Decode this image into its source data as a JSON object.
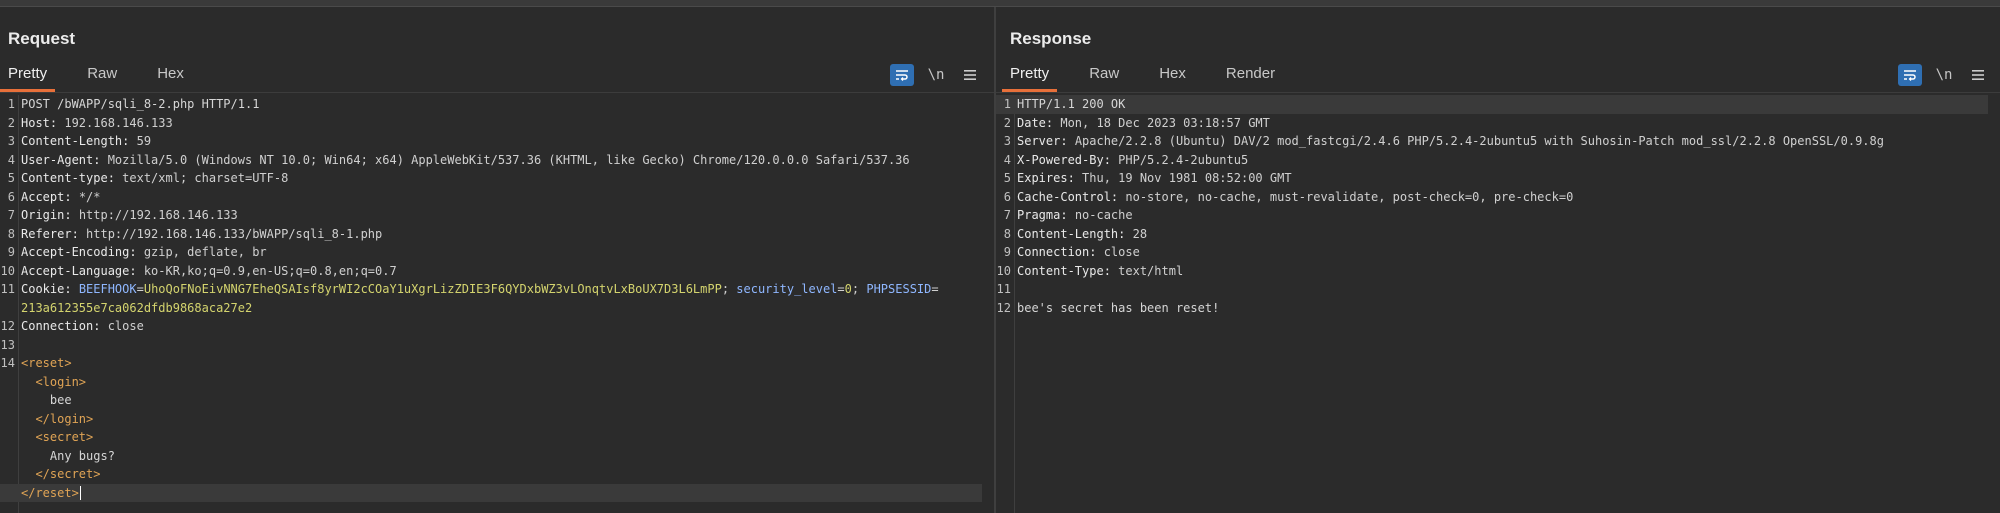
{
  "request": {
    "title": "Request",
    "tabs": [
      "Pretty",
      "Raw",
      "Hex"
    ],
    "active_tab": "Pretty",
    "newline_toggle": "\\n",
    "lines": [
      {
        "n": "1",
        "text": "POST /bWAPP/sqli_8-2.php HTTP/1.1"
      },
      {
        "n": "2",
        "key": "Host",
        "val": "192.168.146.133"
      },
      {
        "n": "3",
        "key": "Content-Length",
        "val": "59"
      },
      {
        "n": "4",
        "key": "User-Agent",
        "val": "Mozilla/5.0 (Windows NT 10.0; Win64; x64) AppleWebKit/537.36 (KHTML, like Gecko) Chrome/120.0.0.0 Safari/537.36"
      },
      {
        "n": "5",
        "key": "Content-type",
        "val": "text/xml; charset=UTF-8"
      },
      {
        "n": "6",
        "key": "Accept",
        "val": "*/*"
      },
      {
        "n": "7",
        "key": "Origin",
        "val": "http://192.168.146.133"
      },
      {
        "n": "8",
        "key": "Referer",
        "val": "http://192.168.146.133/bWAPP/sqli_8-1.php"
      },
      {
        "n": "9",
        "key": "Accept-Encoding",
        "val": "gzip, deflate, br"
      },
      {
        "n": "10",
        "key": "Accept-Language",
        "val": "ko-KR,ko;q=0.9,en-US;q=0.8,en;q=0.7"
      },
      {
        "n": "11",
        "cookie": {
          "key": "Cookie",
          "name1": "BEEFHOOK",
          "val1": "UhoQoFNoEivNNG7EheQSAIsf8yrWI2cCOaY1uXgrLizZDIE3F6QYDxbWZ3vLOnqtvLxBoUX7D3L6LmPP",
          "name2": "security_level",
          "val2": "0",
          "name3": "PHPSESSID",
          "val3a": "",
          "val3b": "213a612355e7ca062dfdb9868aca27e2"
        }
      },
      {
        "n": "12",
        "key": "Connection",
        "val": "close"
      },
      {
        "n": "13",
        "text": ""
      },
      {
        "n": "14",
        "xml": "<reset>"
      },
      {
        "n": "",
        "xml": "  <login>"
      },
      {
        "n": "",
        "xml": "    bee"
      },
      {
        "n": "",
        "xml": "  </login>"
      },
      {
        "n": "",
        "xml": "  <secret>"
      },
      {
        "n": "",
        "xml": "    Any bugs?"
      },
      {
        "n": "",
        "xml": "  </secret>"
      },
      {
        "n": "",
        "xml": "</reset>"
      }
    ]
  },
  "response": {
    "title": "Response",
    "tabs": [
      "Pretty",
      "Raw",
      "Hex",
      "Render"
    ],
    "active_tab": "Pretty",
    "newline_toggle": "\\n",
    "lines": [
      {
        "n": "1",
        "text": "HTTP/1.1 200 OK"
      },
      {
        "n": "2",
        "key": "Date",
        "val": "Mon, 18 Dec 2023 03:18:57 GMT"
      },
      {
        "n": "3",
        "key": "Server",
        "val": "Apache/2.2.8 (Ubuntu) DAV/2 mod_fastcgi/2.4.6 PHP/5.2.4-2ubuntu5 with Suhosin-Patch mod_ssl/2.2.8 OpenSSL/0.9.8g"
      },
      {
        "n": "4",
        "key": "X-Powered-By",
        "val": "PHP/5.2.4-2ubuntu5"
      },
      {
        "n": "5",
        "key": "Expires",
        "val": "Thu, 19 Nov 1981 08:52:00 GMT"
      },
      {
        "n": "6",
        "key": "Cache-Control",
        "val": "no-store, no-cache, must-revalidate, post-check=0, pre-check=0"
      },
      {
        "n": "7",
        "key": "Pragma",
        "val": "no-cache"
      },
      {
        "n": "8",
        "key": "Content-Length",
        "val": "28"
      },
      {
        "n": "9",
        "key": "Connection",
        "val": "close"
      },
      {
        "n": "10",
        "key": "Content-Type",
        "val": "text/html"
      },
      {
        "n": "11",
        "text": ""
      },
      {
        "n": "12",
        "text": "bee's secret has been reset!"
      }
    ]
  },
  "colors": {
    "accent": "#e8703a",
    "toggle_active": "#2f6fb3",
    "cookie_name": "#8fb7ff",
    "cookie_value": "#d4d46e",
    "xml_tag": "#e0a455"
  },
  "icons": {
    "wrap": "wrap-lines-icon",
    "menu": "hamburger-menu-icon",
    "layout": [
      "split-horizontal-icon",
      "split-vertical-icon",
      "single-pane-icon"
    ]
  }
}
